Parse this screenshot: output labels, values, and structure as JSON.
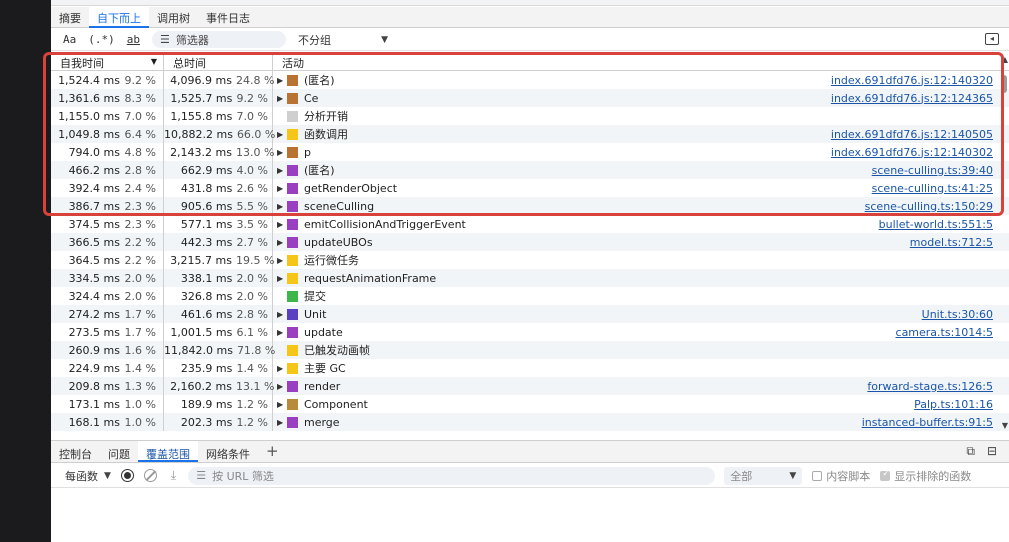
{
  "main_tabs": [
    "摘要",
    "自下而上",
    "调用树",
    "事件日志"
  ],
  "active_main_tab": 1,
  "toolbar": {
    "match_case": "Aa",
    "regex": "(.*)",
    "whole_word": "ab",
    "filter_placeholder": "筛选器",
    "grouping_value": "不分组"
  },
  "table": {
    "headers": {
      "self_time": "自我时间",
      "total_time": "总时间",
      "activity": "活动"
    },
    "rows": [
      {
        "self_ms": "1,524.4 ms",
        "self_pct": "9.2 %",
        "total_ms": "4,096.9 ms",
        "total_pct": "24.8 %",
        "name": "(匿名)",
        "color": "#b87333",
        "expandable": true,
        "source": "index.691dfd76.js:12:140320"
      },
      {
        "self_ms": "1,361.6 ms",
        "self_pct": "8.3 %",
        "total_ms": "1,525.7 ms",
        "total_pct": "9.2 %",
        "name": "Ce",
        "color": "#b87333",
        "expandable": true,
        "source": "index.691dfd76.js:12:124365"
      },
      {
        "self_ms": "1,155.0 ms",
        "self_pct": "7.0 %",
        "total_ms": "1,155.8 ms",
        "total_pct": "7.0 %",
        "name": "分析开销",
        "color": "#cfcfcf",
        "expandable": false,
        "source": ""
      },
      {
        "self_ms": "1,049.8 ms",
        "self_pct": "6.4 %",
        "total_ms": "10,882.2 ms",
        "total_pct": "66.0 %",
        "name": "函数调用",
        "color": "#f5c518",
        "expandable": true,
        "source": "index.691dfd76.js:12:140505"
      },
      {
        "self_ms": "794.0 ms",
        "self_pct": "4.8 %",
        "total_ms": "2,143.2 ms",
        "total_pct": "13.0 %",
        "name": "p",
        "color": "#b87333",
        "expandable": true,
        "source": "index.691dfd76.js:12:140302"
      },
      {
        "self_ms": "466.2 ms",
        "self_pct": "2.8 %",
        "total_ms": "662.9 ms",
        "total_pct": "4.0 %",
        "name": "(匿名)",
        "color": "#9b3fc1",
        "expandable": true,
        "source": "scene-culling.ts:39:40"
      },
      {
        "self_ms": "392.4 ms",
        "self_pct": "2.4 %",
        "total_ms": "431.8 ms",
        "total_pct": "2.6 %",
        "name": "getRenderObject",
        "color": "#9b3fc1",
        "expandable": true,
        "source": "scene-culling.ts:41:25"
      },
      {
        "self_ms": "386.7 ms",
        "self_pct": "2.3 %",
        "total_ms": "905.6 ms",
        "total_pct": "5.5 %",
        "name": "sceneCulling",
        "color": "#9b3fc1",
        "expandable": true,
        "source": "scene-culling.ts:150:29"
      },
      {
        "self_ms": "374.5 ms",
        "self_pct": "2.3 %",
        "total_ms": "577.1 ms",
        "total_pct": "3.5 %",
        "name": "emitCollisionAndTriggerEvent",
        "color": "#9b3fc1",
        "expandable": true,
        "source": "bullet-world.ts:551:5"
      },
      {
        "self_ms": "366.5 ms",
        "self_pct": "2.2 %",
        "total_ms": "442.3 ms",
        "total_pct": "2.7 %",
        "name": "updateUBOs",
        "color": "#9b3fc1",
        "expandable": true,
        "source": "model.ts:712:5"
      },
      {
        "self_ms": "364.5 ms",
        "self_pct": "2.2 %",
        "total_ms": "3,215.7 ms",
        "total_pct": "19.5 %",
        "name": "运行微任务",
        "color": "#f5c518",
        "expandable": true,
        "source": ""
      },
      {
        "self_ms": "334.5 ms",
        "self_pct": "2.0 %",
        "total_ms": "338.1 ms",
        "total_pct": "2.0 %",
        "name": "requestAnimationFrame",
        "color": "#f5c518",
        "expandable": true,
        "source": ""
      },
      {
        "self_ms": "324.4 ms",
        "self_pct": "2.0 %",
        "total_ms": "326.8 ms",
        "total_pct": "2.0 %",
        "name": "提交",
        "color": "#3cb54a",
        "expandable": false,
        "source": ""
      },
      {
        "self_ms": "274.2 ms",
        "self_pct": "1.7 %",
        "total_ms": "461.6 ms",
        "total_pct": "2.8 %",
        "name": "Unit",
        "color": "#5b3fc1",
        "expandable": true,
        "source": "Unit.ts:30:60"
      },
      {
        "self_ms": "273.5 ms",
        "self_pct": "1.7 %",
        "total_ms": "1,001.5 ms",
        "total_pct": "6.1 %",
        "name": "update",
        "color": "#9b3fc1",
        "expandable": true,
        "source": "camera.ts:1014:5"
      },
      {
        "self_ms": "260.9 ms",
        "self_pct": "1.6 %",
        "total_ms": "11,842.0 ms",
        "total_pct": "71.8 %",
        "name": "已触发动画帧",
        "color": "#f5c518",
        "expandable": false,
        "source": ""
      },
      {
        "self_ms": "224.9 ms",
        "self_pct": "1.4 %",
        "total_ms": "235.9 ms",
        "total_pct": "1.4 %",
        "name": "主要 GC",
        "color": "#f5c518",
        "expandable": true,
        "source": ""
      },
      {
        "self_ms": "209.8 ms",
        "self_pct": "1.3 %",
        "total_ms": "2,160.2 ms",
        "total_pct": "13.1 %",
        "name": "render",
        "color": "#9b3fc1",
        "expandable": true,
        "source": "forward-stage.ts:126:5"
      },
      {
        "self_ms": "173.1 ms",
        "self_pct": "1.0 %",
        "total_ms": "189.9 ms",
        "total_pct": "1.2 %",
        "name": "Component",
        "color": "#b88b3a",
        "expandable": true,
        "source": "Palp.ts:101:16"
      },
      {
        "self_ms": "168.1 ms",
        "self_pct": "1.0 %",
        "total_ms": "202.3 ms",
        "total_pct": "1.2 %",
        "name": "merge",
        "color": "#9b3fc1",
        "expandable": true,
        "source": "instanced-buffer.ts:91:5"
      }
    ]
  },
  "drawer": {
    "tabs": [
      "控制台",
      "问题",
      "覆盖范围",
      "网络条件"
    ],
    "active_tab": 2,
    "add_tab": "+"
  },
  "coverage": {
    "per_function": "每函数",
    "url_filter_placeholder": "按 URL 筛选",
    "type_select": "全部",
    "content_scripts": "内容脚本",
    "show_excluded": "显示排除的函数"
  }
}
